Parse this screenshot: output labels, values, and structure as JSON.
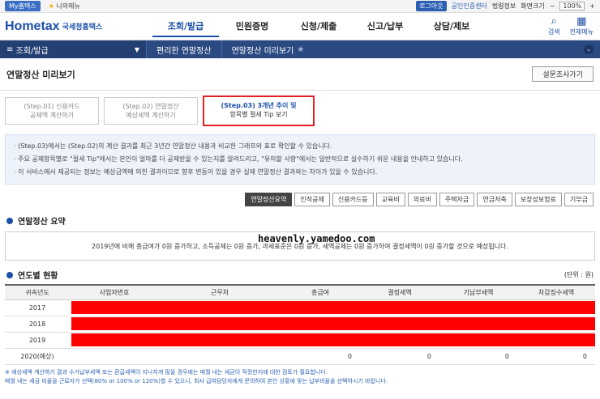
{
  "topbar": {
    "my_label": "My홈택스",
    "fav_label": "나의메뉴",
    "login": "로그아웃",
    "cert": "공인인증센터",
    "personal": "법령정보",
    "zoom_label": "화면크기",
    "zoom_value": "100%"
  },
  "header": {
    "logo": "Hometax",
    "logo_sub": "국세청홈택스",
    "gnb": [
      "조회/발급",
      "민원증명",
      "신청/제출",
      "신고/납부",
      "상담/제보"
    ],
    "search": "검색",
    "allmenu": "전체메뉴"
  },
  "navbar": {
    "menu": "조회/발급",
    "crumb1": "편리한 연말정산",
    "crumb2": "연말정산 미리보기"
  },
  "page": {
    "title": "연말정산 미리보기",
    "survey": "설문조사가기"
  },
  "steps": [
    {
      "line1": "(Step.01) 신용카드",
      "line2": "공제액 계산하기"
    },
    {
      "line1": "(Step.02) 연말정산",
      "line2": "예상세액 계산하기"
    },
    {
      "line1": "(Step.03) 3개년 추이 및",
      "line2": "항목별 절세 Tip 보기"
    }
  ],
  "info": [
    "· (Step.03)에서는 (Step.02)의 계산 결과를 최근 3년간 연말정산 내용과 비교한 그래프와 표로 확인할 수 있습니다.",
    "· 주요 공제항목별로 \"절세 Tip\"에서는 본인이 얼마를 더 공제받을 수 있는지를 알려드리고, \"유의할 사항\"에서는 일반적으로 실수하기 쉬운 내용을 안내하고 있습니다.",
    "· 이 서비스에서 제공되는 정보는 예상금액에 의한 결과이므로 향후 변동이 있을 경우 실제 연말정산 결과와는 차이가 있을 수 있습니다."
  ],
  "tabs": [
    "연말정산요약",
    "인적공제",
    "신용카드등",
    "교육비",
    "의료비",
    "주택자금",
    "연금저축",
    "보장성보험료",
    "기부금"
  ],
  "summary": {
    "title": "연말정산 요약",
    "text": "2019년에 비해 총급여가 0원 증가하고, 소득공제는 0원 증가, 과세표준은 0원 증가, 세액공제는 0원 증가하여 결정세액이 0원 증가할 것으로 예상됩니다."
  },
  "watermark": "heavenly.yamedoo.com",
  "yearly": {
    "title": "연도별 현황",
    "unit": "(단위 : 원)",
    "headers": [
      "귀속년도",
      "사업자번호",
      "근무처",
      "총급여",
      "결정세액",
      "기납부세액",
      "차감징수세액"
    ],
    "rows": [
      {
        "year": "2017"
      },
      {
        "year": "2018"
      },
      {
        "year": "2019"
      },
      {
        "year": "2020(예상)",
        "total": "0",
        "decided": "0",
        "prepaid": "0",
        "diff": "0"
      }
    ]
  },
  "footnote": [
    "※ 예상세액 계산하기 결과 수가납부세액 또는 환급세액이 지나치게 많을 경우에는 매월 내는 세금이 적정한지에 대한 검토가 필요합니다.",
    "   매월 내는 세금 비율을 근로자가 선택(80% or 100% or 120%)할 수 있으니, 회사 급여담당자에게 문의하여 본인 상황에 맞는 납부비율을 선택하시기 바랍니다."
  ],
  "colors": {
    "brand": "#1c4fa8",
    "nav": "#2b4a82",
    "highlight": "#e32222",
    "redact": "#ff0000"
  }
}
